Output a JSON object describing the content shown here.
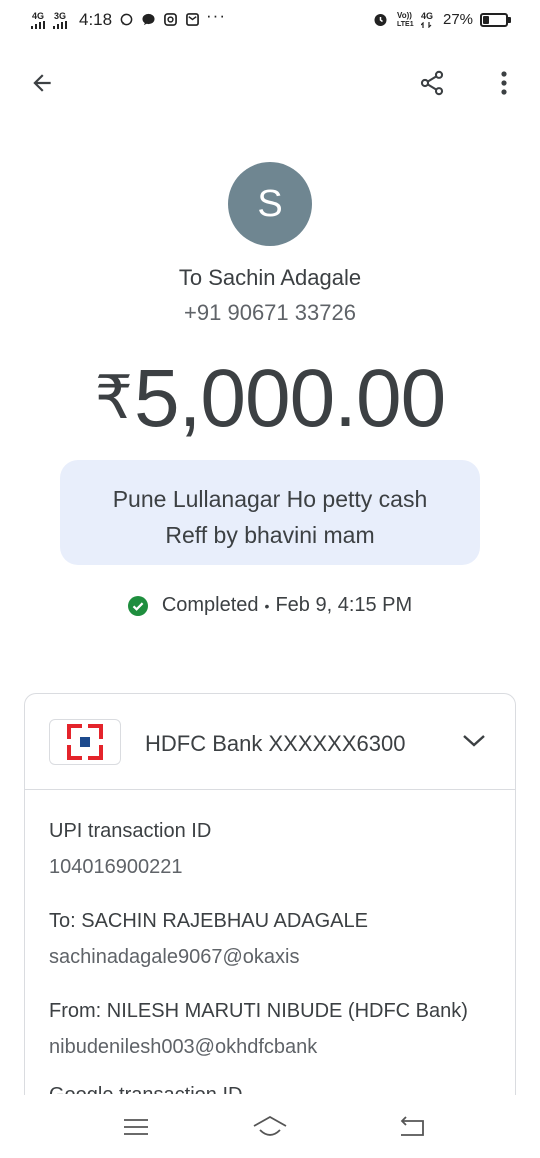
{
  "status_bar": {
    "net1": "4G",
    "net2": "3G",
    "time": "4:18",
    "more": "···",
    "volte": "Vo))",
    "lte": "LTE1",
    "net3": "4G",
    "battery_percent_text": "27%",
    "battery_level": 0.27
  },
  "app_bar": {
    "back_icon": "arrow-back",
    "share_icon": "share",
    "more_icon": "more-vert"
  },
  "payee": {
    "avatar_letter": "S",
    "avatar_color": "#6f8691",
    "name": "To Sachin Adagale",
    "phone": "+91 90671 33726"
  },
  "amount": {
    "currency": "₹",
    "value": "5,000.00"
  },
  "note": {
    "line1": "Pune Lullanagar Ho petty cash",
    "line2": "Reff by bhavini mam"
  },
  "status": {
    "text": "Completed",
    "separator": "•",
    "datetime": "Feb 9, 4:15 PM",
    "color": "#1e8e3e"
  },
  "card": {
    "bank": "HDFC Bank XXXXXX6300",
    "fields": [
      {
        "label": "UPI transaction ID",
        "value": "104016900221"
      },
      {
        "label": "To: SACHIN RAJEBHAU ADAGALE",
        "value": "sachinadagale9067@okaxis"
      },
      {
        "label": "From: NILESH MARUTI NIBUDE (HDFC Bank)",
        "value": "nibudenilesh003@okhdfcbank"
      }
    ],
    "partial_label": "Google transaction ID"
  }
}
